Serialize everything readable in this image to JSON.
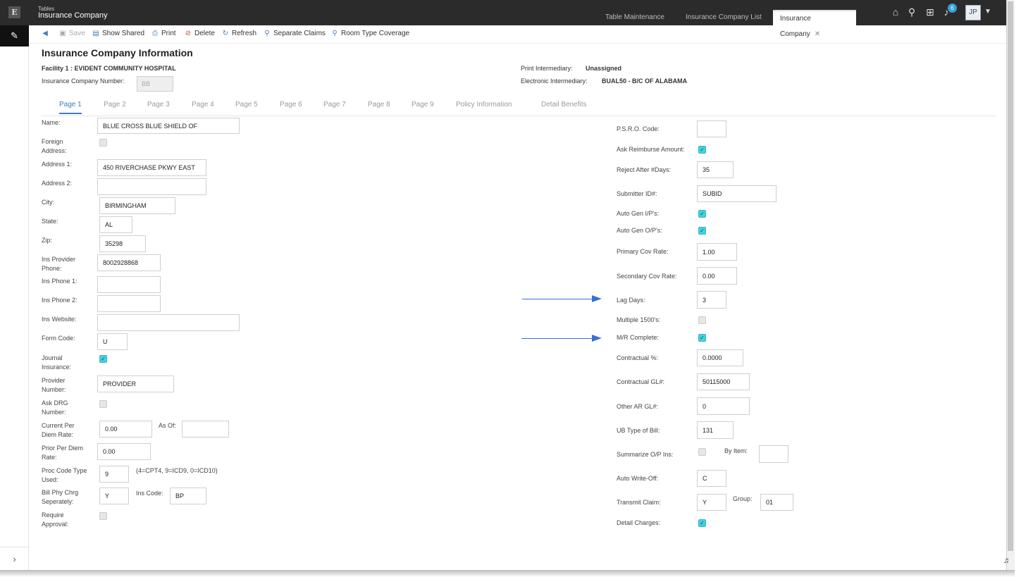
{
  "header": {
    "app_small": "Tables",
    "app_title": "Insurance Company",
    "logo_letter": "E",
    "tabs": [
      {
        "label": "Table Maintenance"
      },
      {
        "label": "Insurance Company List"
      },
      {
        "label": "Insurance Company",
        "close": "✕"
      }
    ],
    "notification_count": "6",
    "user_initials": "JP",
    "icons": [
      "home-icon",
      "search-icon",
      "grid-icon",
      "bell-icon",
      "caret-down-icon"
    ]
  },
  "toolbar": {
    "items": [
      {
        "label": "",
        "icon": "back-arrow-icon"
      },
      {
        "label": "Save",
        "icon": "save-icon"
      },
      {
        "label": "Show Shared",
        "icon": "shared-icon"
      },
      {
        "label": "Print",
        "icon": "print-icon"
      },
      {
        "label": "Delete",
        "icon": "delete-icon"
      },
      {
        "label": "Refresh",
        "icon": "refresh-icon"
      },
      {
        "label": "Separate Claims",
        "icon": "search-icon"
      },
      {
        "label": "Room Type Coverage",
        "icon": "search-icon"
      }
    ]
  },
  "page": {
    "title": "Insurance Company Information",
    "facility": "Facility 1 : EVIDENT COMMUNITY HOSPITAL",
    "ins_company_number_label": "Insurance Company Number:",
    "ins_company_number_value": "BB",
    "print_intermediary_label": "Print Intermediary:",
    "print_intermediary_value": "Unassigned",
    "electronic_intermediary_label": "Electronic Intermediary:",
    "electronic_intermediary_value": "BUAL50 - B/C OF ALABAMA"
  },
  "page_tabs": [
    "Page 1",
    "Page 2",
    "Page 3",
    "Page 4",
    "Page 5",
    "Page 6",
    "Page 7",
    "Page 8",
    "Page 9",
    "Policy Information",
    "Detail Benefits"
  ],
  "left": {
    "name": {
      "label": "Name:",
      "value": "BLUE CROSS BLUE SHIELD OF"
    },
    "foreign_address": {
      "label": "Foreign Address:",
      "checked": false
    },
    "address1": {
      "label": "Address 1:",
      "value": "450 RIVERCHASE PKWY EAST"
    },
    "address2": {
      "label": "Address 2:",
      "value": ""
    },
    "city": {
      "label": "City:",
      "value": "BIRMINGHAM"
    },
    "state": {
      "label": "State:",
      "value": "AL"
    },
    "zip": {
      "label": "Zip:",
      "value": "35298"
    },
    "ins_provider_phone": {
      "label": "Ins Provider Phone:",
      "value": "8002928868"
    },
    "ins_phone1": {
      "label": "Ins Phone 1:",
      "value": ""
    },
    "ins_phone2": {
      "label": "Ins Phone 2:",
      "value": ""
    },
    "ins_website": {
      "label": "Ins Website:",
      "value": ""
    },
    "form_code": {
      "label": "Form Code:",
      "value": "U"
    },
    "journal_insurance": {
      "label": "Journal Insurance:",
      "checked": true
    },
    "provider_number": {
      "label": "Provider Number:",
      "value": "PROVIDER"
    },
    "ask_drg_number": {
      "label": "Ask DRG Number:",
      "checked": false
    },
    "current_per_diem_rate": {
      "label": "Current Per Diem Rate:",
      "value": "0.00"
    },
    "as_of": {
      "label": "As Of:",
      "value": ""
    },
    "prior_per_diem_rate": {
      "label": "Prior Per Diem Rate:",
      "value": "0.00"
    },
    "proc_code_type_used": {
      "label": "Proc Code Type Used:",
      "value": "9",
      "note": "(4=CPT4, 9=ICD9, 0=ICD10)"
    },
    "bill_phy_chrg_separately": {
      "label": "Bill Phy Chrg Seperately:",
      "value": "Y"
    },
    "ins_code": {
      "label": "Ins Code:",
      "value": "BP"
    },
    "require_approval": {
      "label": "Require Approval:",
      "checked": false
    }
  },
  "right": {
    "psro_code": {
      "label": "P.S.R.O. Code:",
      "value": ""
    },
    "ask_reimburse_amount": {
      "label": "Ask Reimburse Amount:",
      "checked": true
    },
    "reject_after_days": {
      "label": "Reject After #Days:",
      "value": "35"
    },
    "submitter_id": {
      "label": "Submitter ID#:",
      "value": "SUBID"
    },
    "auto_gen_ips": {
      "label": "Auto Gen I/P's:",
      "checked": true
    },
    "auto_gen_ops": {
      "label": "Auto Gen O/P's:",
      "checked": true
    },
    "primary_cov_rate": {
      "label": "Primary Cov Rate:",
      "value": "1.00"
    },
    "secondary_cov_rate": {
      "label": "Secondary Cov Rate:",
      "value": "0.00"
    },
    "lag_days": {
      "label": "Lag Days:",
      "value": "3"
    },
    "multiple_1500s": {
      "label": "Multiple 1500's:",
      "checked": false
    },
    "mr_complete": {
      "label": "M/R Complete:",
      "checked": true
    },
    "contractual_pct": {
      "label": "Contractual %:",
      "value": "0.0000"
    },
    "contractual_gl": {
      "label": "Contractual GL#:",
      "value": "50115000"
    },
    "other_ar_gl": {
      "label": "Other AR GL#:",
      "value": "0"
    },
    "ub_type_of_bill": {
      "label": "UB Type of Bill:",
      "value": "131"
    },
    "summarize_op_ins": {
      "label": "Summarize O/P Ins:",
      "checked": false
    },
    "by_item": {
      "label": "By Item:",
      "value": ""
    },
    "auto_write_off": {
      "label": "Auto Write-Off:",
      "value": "C"
    },
    "transmit_claim": {
      "label": "Transmit Claim:",
      "value": "Y"
    },
    "group": {
      "label": "Group:",
      "value": "01"
    },
    "detail_charges": {
      "label": "Detail Charges:",
      "checked": true
    }
  },
  "colors": {
    "header_bg": "#2b2b2b",
    "accent": "#3a7bbf",
    "checkbox_on": "#3fd4df",
    "annotation_arrow": "#3a6fd8"
  }
}
